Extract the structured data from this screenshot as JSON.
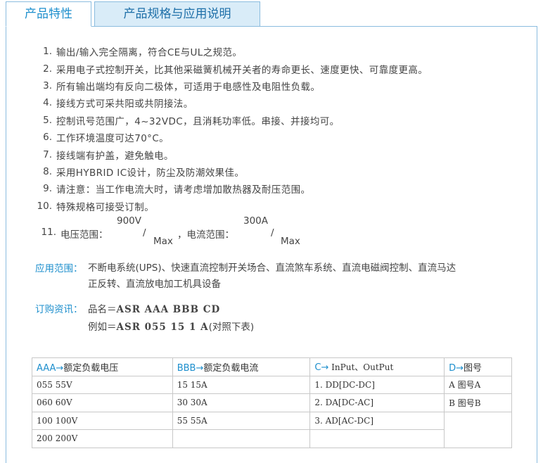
{
  "tabs": [
    {
      "label": "产品特性",
      "active": true
    },
    {
      "label": "产品规格与应用说明",
      "active": false
    }
  ],
  "features": [
    {
      "num": "1.",
      "text": "输出/输入完全隔离，符合CE与UL之规范。"
    },
    {
      "num": "2.",
      "text": "采用电子式控制开关，比其他采磁簧机械开关者的寿命更长、速度更快、可靠度更高。"
    },
    {
      "num": "3.",
      "text": "所有输出端均有反向二极体，可适用于电感性及电阻性负载。"
    },
    {
      "num": "4.",
      "text": "接线方式可采共阳或共阴接法。"
    },
    {
      "num": "5.",
      "text": "控制讯号范围广，4~32VDC，且消耗功率低。串接、并接均可。"
    },
    {
      "num": "6.",
      "text": "工作环境温度可达70°C。"
    },
    {
      "num": "7.",
      "text": "接线端有护盖，避免触电。"
    },
    {
      "num": "8.",
      "text": "采用HYBRID IC设计，防尘及防潮效果佳。"
    },
    {
      "num": "9.",
      "text": "请注意：当工作电流大时，请考虑增加散热器及耐压范围。"
    },
    {
      "num": "10.",
      "text": "特殊规格可接受订制。"
    }
  ],
  "feature11": {
    "num": "11.",
    "voltage_label": "电压范围：",
    "voltage_value": "900V",
    "slash1": "/",
    "max1": "Max",
    "current_label": "，电流范围：",
    "current_value": "300A",
    "slash2": "/",
    "max2": "Max"
  },
  "application": {
    "label": "应用范围：",
    "line1": "不断电系统(UPS)、快速直流控制开关场合、直流煞车系统、直流电磁阀控制、直流马达",
    "line2": "正反转、直流放电加工机具设备"
  },
  "order": {
    "label": "订购资讯：",
    "name_prefix": "品名＝",
    "name_code": "ASR AAA BBB CD",
    "example_prefix": "例如＝",
    "example_code": "ASR 055 15 1 A",
    "example_note": "(对照下表)"
  },
  "spec_table": {
    "headers": [
      {
        "code": "AAA→",
        "label": "额定负载电压"
      },
      {
        "code": "BBB→",
        "label": "额定负载电流"
      },
      {
        "code": "C→",
        "label": " InPut、OutPut"
      },
      {
        "code": "D→",
        "label": "图号"
      }
    ],
    "rows": [
      [
        "055 55V",
        "15 15A",
        "1. DD[DC-DC]",
        "A 图号A"
      ],
      [
        "060 60V",
        "30 30A",
        "2. DA[DC-AC]",
        "B 图号B"
      ],
      [
        "100 100V",
        "55 55A",
        "3. AD[AC-DC]",
        ""
      ],
      [
        "200 200V",
        "",
        "",
        ""
      ]
    ]
  },
  "colors": {
    "accent": "#1e8fcd",
    "tab_inactive_bg": "#d9ecf8",
    "border": "#8bbcdf"
  }
}
